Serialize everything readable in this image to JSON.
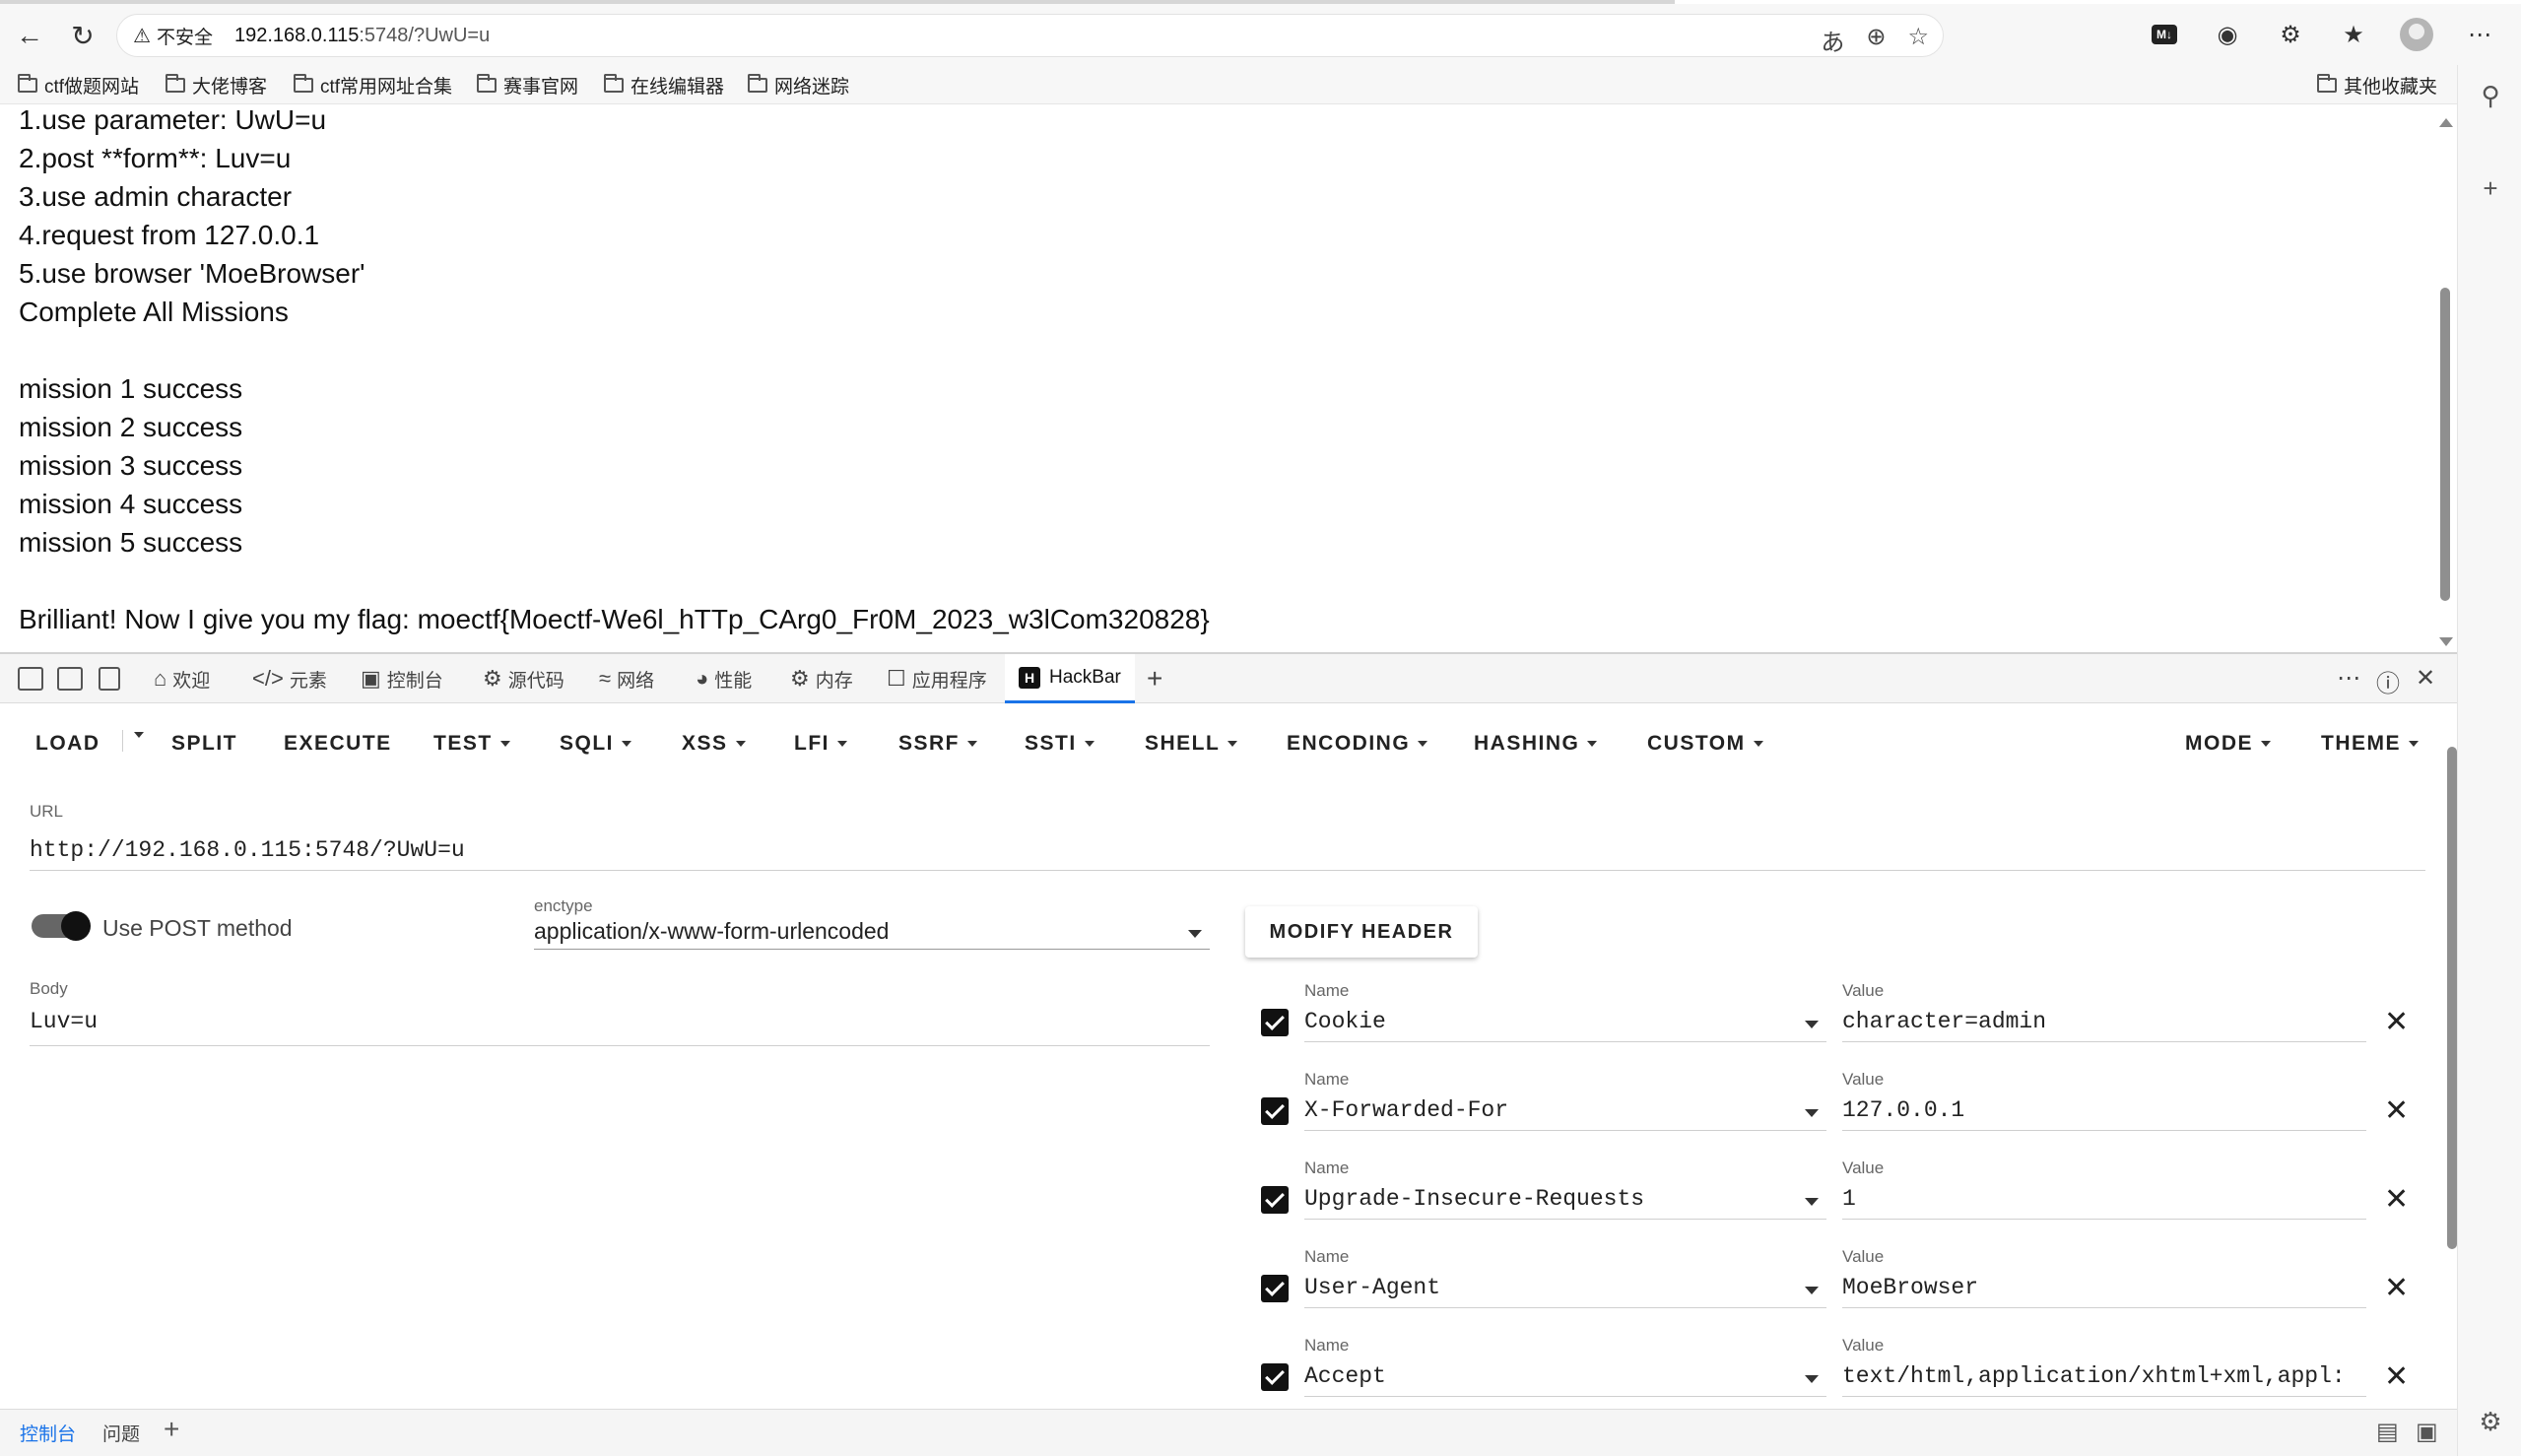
{
  "browser": {
    "insecure_label": "不安全",
    "url_host": "192.168.0.115",
    "url_rest": ":5748/?UwU=u",
    "bookmarks": [
      "ctf做题网站",
      "大佬博客",
      "ctf常用网址合集",
      "赛事官网",
      "在线编辑器",
      "网络迷踪"
    ],
    "other_bookmarks": "其他收藏夹"
  },
  "page": {
    "lines": [
      "1.use parameter: UwU=u",
      "2.post **form**: Luv=u",
      "3.use admin character",
      "4.request from 127.0.0.1",
      "5.use browser 'MoeBrowser'",
      "Complete All Missions",
      "mission 1 success",
      "mission 2 success",
      "mission 3 success",
      "mission 4 success",
      "mission 5 success",
      "Brilliant! Now I give you my flag: moectf{Moectf-We6l_hTTp_CArg0_Fr0M_2023_w3lCom320828}"
    ]
  },
  "devtools": {
    "tabs": [
      "欢迎",
      "元素",
      "控制台",
      "源代码",
      "网络",
      "性能",
      "内存",
      "应用程序",
      "HackBar"
    ],
    "drawer_tabs": [
      "控制台",
      "问题"
    ]
  },
  "hackbar": {
    "menu": [
      "LOAD",
      "SPLIT",
      "EXECUTE",
      "TEST",
      "SQLI",
      "XSS",
      "LFI",
      "SSRF",
      "SSTI",
      "SHELL",
      "ENCODING",
      "HASHING",
      "CUSTOM",
      "MODE",
      "THEME"
    ],
    "url_label": "URL",
    "url_value": "http://192.168.0.115:5748/?UwU=u",
    "post_toggle_label": "Use POST method",
    "enctype_label": "enctype",
    "enctype_value": "application/x-www-form-urlencoded",
    "modify_header_label": "MODIFY HEADER",
    "body_label": "Body",
    "body_value": "Luv=u",
    "name_label": "Name",
    "value_label": "Value",
    "headers": [
      {
        "name": "Cookie",
        "value": "character=admin"
      },
      {
        "name": "X-Forwarded-For",
        "value": "127.0.0.1"
      },
      {
        "name": "Upgrade-Insecure-Requests",
        "value": "1"
      },
      {
        "name": "User-Agent",
        "value": "MoeBrowser"
      },
      {
        "name": "Accept",
        "value": "text/html,application/xhtml+xml,appl:"
      }
    ]
  },
  "icons": {
    "back": "back-arrow-icon",
    "reload": "reload-icon",
    "translate": "translate-icon",
    "zoom": "zoom-icon",
    "favorite": "star-icon",
    "close": "close-icon"
  }
}
